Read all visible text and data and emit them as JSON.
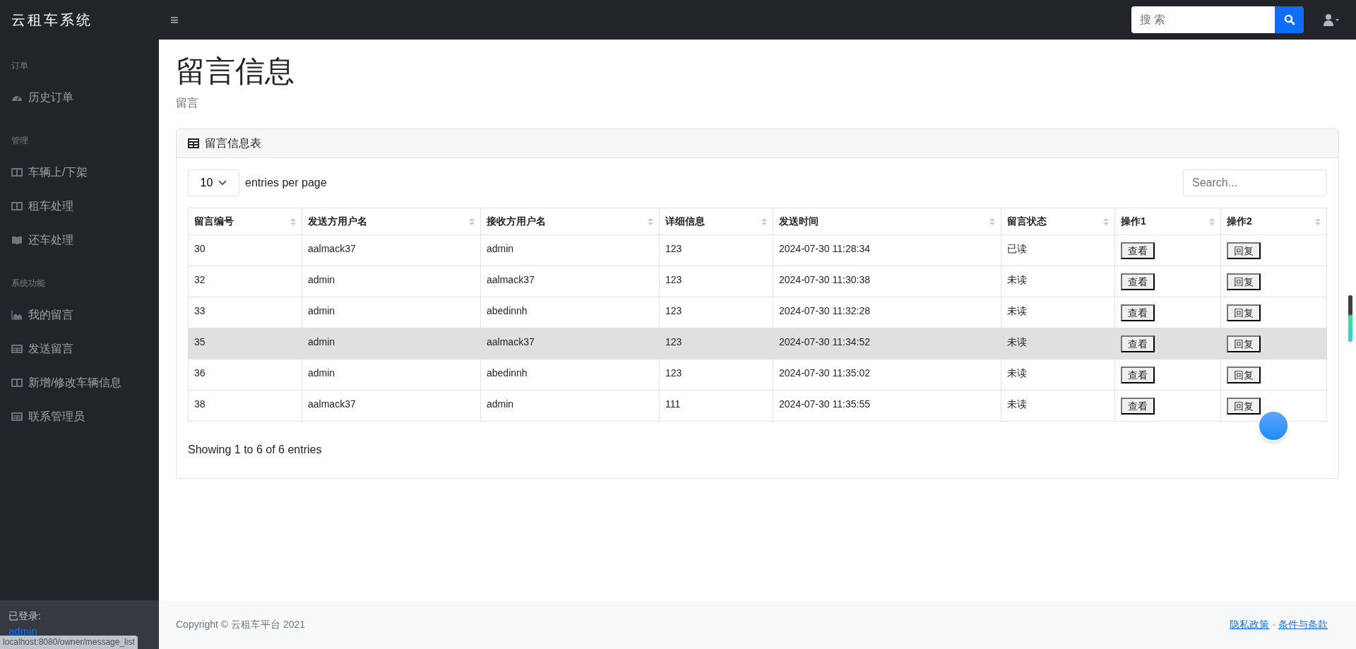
{
  "brand": "云租车系统",
  "navbar": {
    "menu_glyph": "≡",
    "search": {
      "placeholder": "搜 索"
    }
  },
  "sidebar": {
    "sections": [
      {
        "heading": "订单",
        "items": [
          {
            "label": "历史订单",
            "kind": "gauge"
          }
        ]
      },
      {
        "heading": "管理",
        "items": [
          {
            "label": "车辆上/下架",
            "kind": "columns"
          },
          {
            "label": "租车处理",
            "kind": "columns"
          },
          {
            "label": "还车处理",
            "kind": "book"
          }
        ]
      },
      {
        "heading": "系统功能",
        "items": [
          {
            "label": "我的留言",
            "kind": "chart"
          },
          {
            "label": "发送留言",
            "kind": "table"
          },
          {
            "label": "新增/修改车辆信息",
            "kind": "columns"
          },
          {
            "label": "联系管理员",
            "kind": "table"
          }
        ]
      }
    ],
    "footer": {
      "label": "已登录:",
      "user": "admin"
    }
  },
  "page": {
    "title": "留言信息",
    "subtitle": "留言"
  },
  "card": {
    "title": "留言信息表",
    "page_size": "10",
    "page_size_label": "entries per page",
    "search": {
      "placeholder": "Search..."
    },
    "table": {
      "columns": [
        "留言编号",
        "发送方用户名",
        "接收方用户名",
        "详细信息",
        "发送时间",
        "留言状态",
        "操作1",
        "操作2"
      ],
      "rows": [
        {
          "cells": [
            "30",
            "aalmack37",
            "admin",
            "123",
            "2024-07-30 11:28:34",
            "已读"
          ],
          "actions": [
            "查看",
            "回复"
          ],
          "highlighted": false
        },
        {
          "cells": [
            "32",
            "admin",
            "aalmack37",
            "123",
            "2024-07-30 11:30:38",
            "未读"
          ],
          "actions": [
            "查看",
            "回复"
          ],
          "highlighted": false
        },
        {
          "cells": [
            "33",
            "admin",
            "abedinnh",
            "123",
            "2024-07-30 11:32:28",
            "未读"
          ],
          "actions": [
            "查看",
            "回复"
          ],
          "highlighted": false
        },
        {
          "cells": [
            "35",
            "admin",
            "aalmack37",
            "123",
            "2024-07-30 11:34:52",
            "未读"
          ],
          "actions": [
            "查看",
            "回复"
          ],
          "highlighted": true
        },
        {
          "cells": [
            "36",
            "admin",
            "abedinnh",
            "123",
            "2024-07-30 11:35:02",
            "未读"
          ],
          "actions": [
            "查看",
            "回复"
          ],
          "highlighted": false
        },
        {
          "cells": [
            "38",
            "aalmack37",
            "admin",
            "111",
            "2024-07-30 11:35:55",
            "未读"
          ],
          "actions": [
            "查看",
            "回复"
          ],
          "highlighted": false
        }
      ]
    },
    "info": "Showing 1 to 6 of 6 entries"
  },
  "footer": {
    "copyright": "Copyright © 云租车平台 2021",
    "links": [
      "隐私政策",
      "·",
      "条件与条款"
    ]
  },
  "browser_status": "localhost:8080/owner/message_list"
}
